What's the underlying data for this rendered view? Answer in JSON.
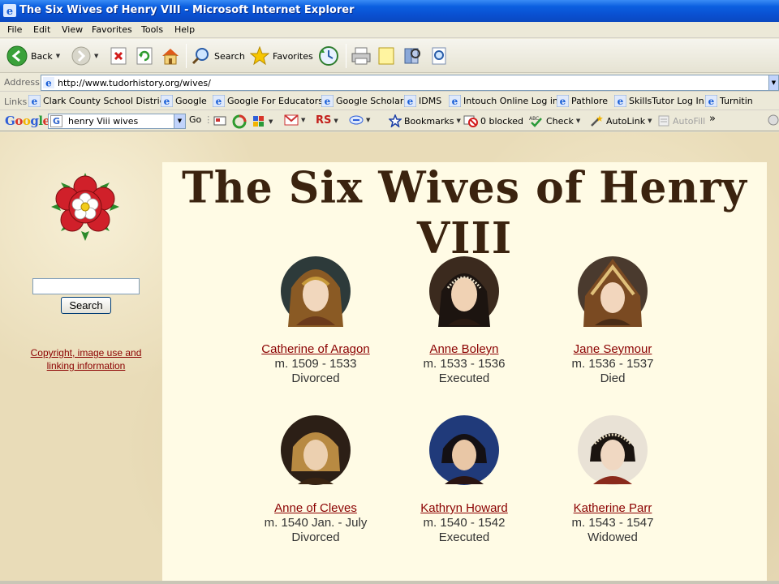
{
  "window": {
    "title": "The Six Wives of Henry VIII - Microsoft Internet Explorer"
  },
  "menu": [
    "File",
    "Edit",
    "View",
    "Favorites",
    "Tools",
    "Help"
  ],
  "toolbar": {
    "back_label": "Back",
    "search_label": "Search",
    "favorites_label": "Favorites"
  },
  "address": {
    "label": "Address",
    "url": "http://www.tudorhistory.org/wives/"
  },
  "links": {
    "label": "Links",
    "items": [
      "Clark County School District",
      "Google",
      "Google For Educators",
      "Google Scholar",
      "IDMS",
      "Intouch Online Log in",
      "Pathlore",
      "SkillsTutor Log In",
      "Turnitin"
    ]
  },
  "google_bar": {
    "logo": "Google",
    "query": "henry Viii wives",
    "go_label": "Go",
    "bookmarks_label": "Bookmarks",
    "blocked_label": "0 blocked",
    "check_label": "Check",
    "autolink_label": "AutoLink",
    "autofill_label": "AutoFill",
    "more": "»"
  },
  "sidebar": {
    "search_value": "",
    "search_button": "Search",
    "copyright_line1": "Copyright, image use and",
    "copyright_line2": "linking information"
  },
  "page": {
    "title": "The Six Wives of Henry VIII"
  },
  "wives": [
    {
      "name": "Catherine of Aragon",
      "years": "m. 1509 - 1533",
      "fate": "Divorced"
    },
    {
      "name": "Anne Boleyn",
      "years": "m. 1533 - 1536",
      "fate": "Executed"
    },
    {
      "name": "Jane Seymour",
      "years": "m. 1536 - 1537",
      "fate": "Died"
    },
    {
      "name": "Anne of Cleves",
      "years": "m. 1540 Jan. - July",
      "fate": "Divorced"
    },
    {
      "name": "Kathryn Howard",
      "years": "m. 1540 - 1542",
      "fate": "Executed"
    },
    {
      "name": "Katherine Parr",
      "years": "m. 1543 - 1547",
      "fate": "Widowed"
    }
  ]
}
